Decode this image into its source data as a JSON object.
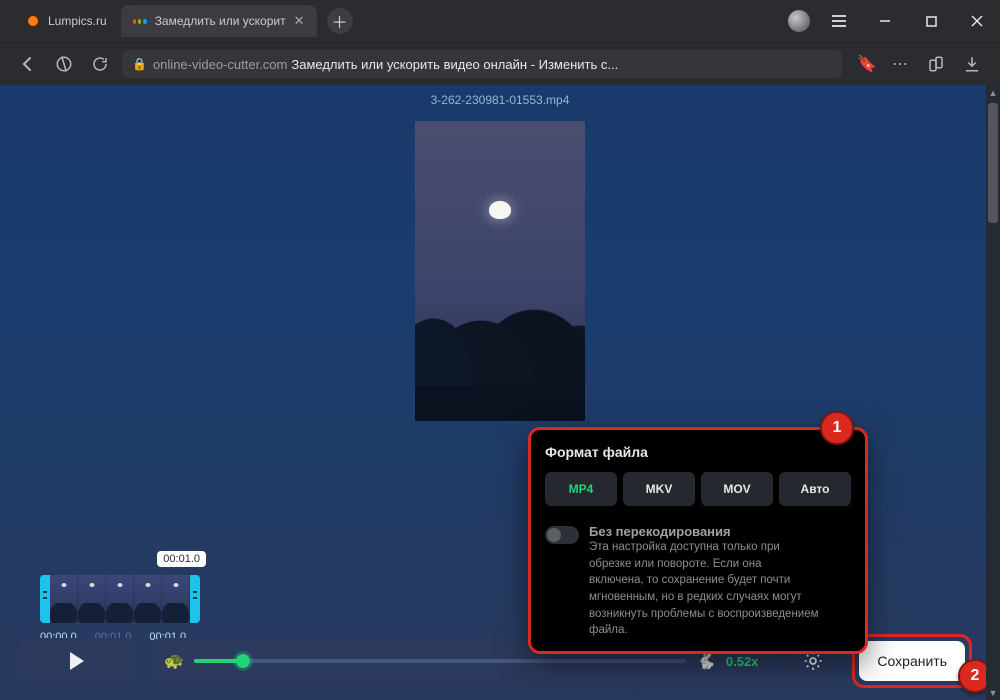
{
  "chrome": {
    "tabs": [
      {
        "label": "Lumpics.ru"
      },
      {
        "label": "Замедлить или ускорит"
      }
    ],
    "address": {
      "domain": "online-video-cutter.com",
      "page_title": "Замедлить или ускорить видео онлайн - Изменить с..."
    }
  },
  "app": {
    "filename": "3-262-230981-01553.mp4",
    "timeline": {
      "handle_tooltip": "00:01.0",
      "marks": [
        "00:00.0",
        "00:01.0",
        "00:01.0"
      ]
    },
    "controls": {
      "speed_label": "0.52x",
      "save_label": "Сохранить"
    },
    "popup": {
      "title": "Формат файла",
      "formats": [
        "MP4",
        "MKV",
        "MOV",
        "Авто"
      ],
      "toggle_label": "Без перекодирования",
      "toggle_desc": "Эта настройка доступна только при обрезке или повороте. Если она включена, то сохранение будет почти мгновенным, но в редких случаях могут возникнуть проблемы с воспроизведением файла."
    },
    "callouts": {
      "one": "1",
      "two": "2"
    }
  }
}
